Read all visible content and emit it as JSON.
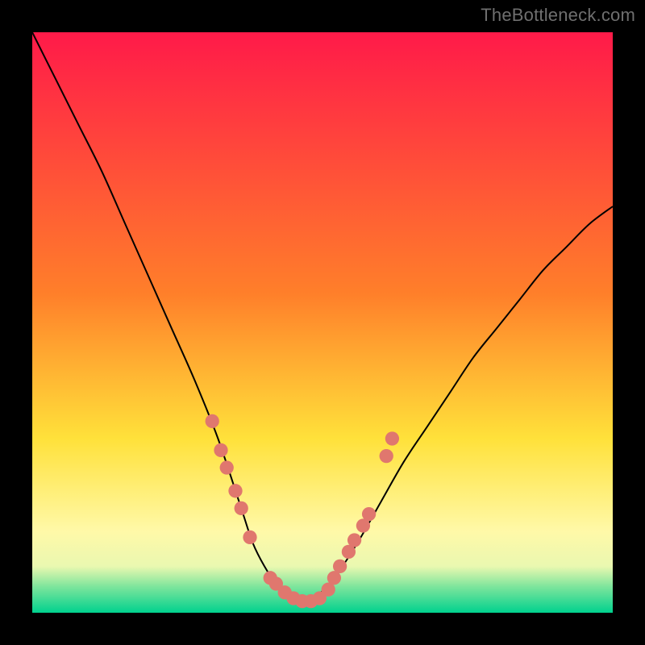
{
  "watermark": "TheBottleneck.com",
  "chart_data": {
    "type": "line",
    "title": "",
    "xlabel": "",
    "ylabel": "",
    "xlim": [
      0,
      100
    ],
    "ylim": [
      0,
      100
    ],
    "grid": false,
    "background_gradient": {
      "stops": [
        {
          "pos": 0.0,
          "color": "#ff1a49"
        },
        {
          "pos": 0.45,
          "color": "#ff7f2a"
        },
        {
          "pos": 0.7,
          "color": "#ffe13a"
        },
        {
          "pos": 0.86,
          "color": "#fff9a8"
        },
        {
          "pos": 0.92,
          "color": "#eaf8b0"
        },
        {
          "pos": 0.955,
          "color": "#7ee59c"
        },
        {
          "pos": 1.0,
          "color": "#00d18e"
        }
      ]
    },
    "series": [
      {
        "name": "bottleneck-curve",
        "color": "#000000",
        "x": [
          0,
          4,
          8,
          12,
          16,
          20,
          24,
          28,
          32,
          36,
          38,
          40,
          42,
          44,
          46,
          48,
          52,
          56,
          60,
          64,
          68,
          72,
          76,
          80,
          84,
          88,
          92,
          96,
          100
        ],
        "values": [
          100,
          92,
          84,
          76,
          67,
          58,
          49,
          40,
          30,
          18,
          12,
          8,
          5,
          3,
          2,
          2,
          6,
          12,
          19,
          26,
          32,
          38,
          44,
          49,
          54,
          59,
          63,
          67,
          70
        ]
      }
    ],
    "markers": {
      "name": "data-points",
      "color": "#e0776e",
      "radius_pct": 1.2,
      "points": [
        {
          "x": 31.0,
          "y": 33
        },
        {
          "x": 32.5,
          "y": 28
        },
        {
          "x": 33.5,
          "y": 25
        },
        {
          "x": 35.0,
          "y": 21
        },
        {
          "x": 36.0,
          "y": 18
        },
        {
          "x": 37.5,
          "y": 13
        },
        {
          "x": 41.0,
          "y": 6
        },
        {
          "x": 42.0,
          "y": 5
        },
        {
          "x": 43.5,
          "y": 3.5
        },
        {
          "x": 45.0,
          "y": 2.5
        },
        {
          "x": 46.5,
          "y": 2
        },
        {
          "x": 48.0,
          "y": 2
        },
        {
          "x": 49.5,
          "y": 2.5
        },
        {
          "x": 51.0,
          "y": 4
        },
        {
          "x": 52.0,
          "y": 6
        },
        {
          "x": 53.0,
          "y": 8
        },
        {
          "x": 54.5,
          "y": 10.5
        },
        {
          "x": 55.5,
          "y": 12.5
        },
        {
          "x": 57.0,
          "y": 15
        },
        {
          "x": 58.0,
          "y": 17
        },
        {
          "x": 61.0,
          "y": 27
        },
        {
          "x": 62.0,
          "y": 30
        }
      ]
    }
  }
}
